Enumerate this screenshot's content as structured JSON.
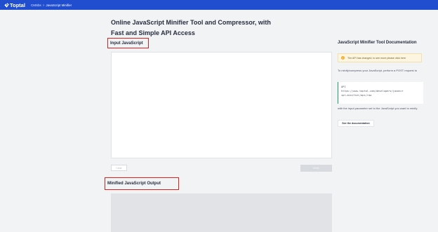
{
  "header": {
    "brand": "Toptal",
    "breadcrumb": {
      "parent": "CMSbs",
      "separator": ">",
      "current": "JavaScript Minifier"
    },
    "bar_color": "#204ecf"
  },
  "main": {
    "title_line1": "Online JavaScript Minifier Tool and Compressor, with",
    "title_line2": "Fast and Simple API Access",
    "input_label": "Input JavaScript",
    "input_value": "",
    "clear_button": "Clear",
    "minify_button": "Minify",
    "output_label": "Minified JavaScript Output",
    "output_value": ""
  },
  "docs": {
    "title": "JavaScript Minifier Tool Documentation",
    "notice": "The API has changed, to see more please click here",
    "description": "To minify/compress your JavaScript, perform a POST request to",
    "api_label": "API",
    "api_url_line1": "https://www.toptal.com/developers/javascr",
    "api_url_line2": "ipt-minifier/api/raw",
    "description2": "with the input parameter set to the JavaScript you want to minify.",
    "doc_button": "See the documentation"
  },
  "colors": {
    "highlight_box": "#e0201f",
    "api_accent": "#15a85f",
    "notice_bg": "#fdf5df"
  },
  "icons": {
    "brand": "toptal-logo-icon",
    "notice": "warning-icon"
  }
}
